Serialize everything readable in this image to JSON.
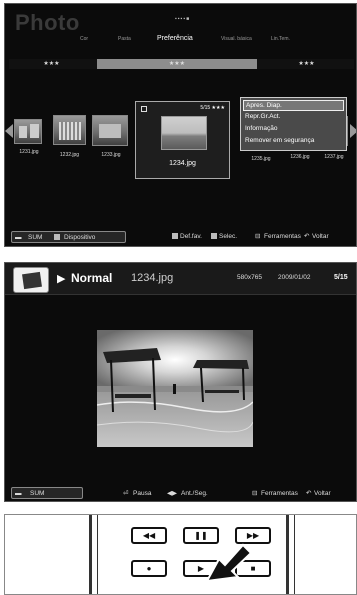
{
  "browser": {
    "title": "Photo",
    "dots": "▪▪▪▪■",
    "tabs": [
      "Cor",
      "Pasta",
      "Preferência",
      "Visual. básica",
      "Lin.Tem."
    ],
    "star_segments": [
      "★★★",
      "★★★",
      "★★★"
    ],
    "thumbs": [
      "1231.jpg",
      "1232.jpg",
      "1233.jpg",
      "1235.jpg",
      "1236.jpg",
      "1237.jpg"
    ],
    "selected": {
      "name": "1234.jpg",
      "count": "5/15 ★★★"
    },
    "menu": [
      "Apres. Diap.",
      "Repr.Gr.Act.",
      "Informação",
      "Remover em segurança"
    ],
    "bottom": {
      "sum": "SUM",
      "device": "Dispositivo",
      "fav": "Def.fav.",
      "select": "Selec.",
      "tools": "Ferramentas",
      "back": "Voltar"
    }
  },
  "slideshow": {
    "mode": "Normal",
    "file": "1234.jpg",
    "resolution": "580x765",
    "date": "2009/01/02",
    "count": "5/15",
    "bottom": {
      "sum": "SUM",
      "pause": "Pausa",
      "prevnext": "Ant./Seg.",
      "tools": "Ferramentas",
      "back": "Voltar"
    }
  },
  "remote": {
    "buttons": [
      "◀◀",
      "❚❚",
      "▶▶",
      "●",
      "▶",
      "■"
    ]
  }
}
